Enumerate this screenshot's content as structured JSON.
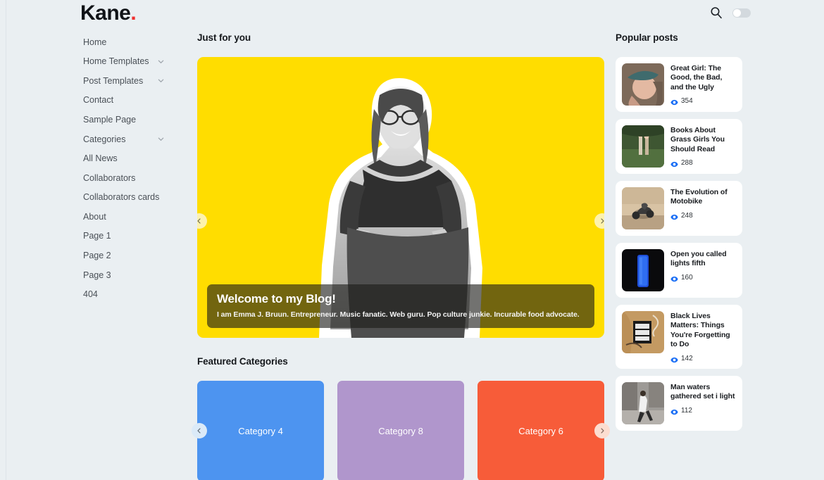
{
  "brand": {
    "name": "Kane",
    "dot": ".",
    "dot_color": "#f02f2f"
  },
  "header": {
    "search_icon": "search-icon",
    "toggle_state": "off"
  },
  "sidebar": {
    "items": [
      {
        "label": "Home",
        "expandable": false
      },
      {
        "label": "Home Templates",
        "expandable": true
      },
      {
        "label": "Post Templates",
        "expandable": true
      },
      {
        "label": "Contact",
        "expandable": false
      },
      {
        "label": "Sample Page",
        "expandable": false
      },
      {
        "label": "Categories",
        "expandable": true
      },
      {
        "label": "All News",
        "expandable": false
      },
      {
        "label": "Collaborators",
        "expandable": false
      },
      {
        "label": "Collaborators cards",
        "expandable": false
      },
      {
        "label": "About",
        "expandable": false
      },
      {
        "label": "Page 1",
        "expandable": false
      },
      {
        "label": "Page 2",
        "expandable": false
      },
      {
        "label": "Page 3",
        "expandable": false
      },
      {
        "label": "404",
        "expandable": false
      }
    ]
  },
  "main": {
    "just_for_you_title": "Just for you",
    "hero": {
      "background_color": "#ffdd00",
      "heading": "Welcome to my Blog!",
      "subheading": "I am Emma J. Bruun. Entrepreneur. Music fanatic. Web guru. Pop culture junkie. Incurable food advocate.",
      "prev_label": "‹",
      "next_label": "›"
    },
    "featured_title": "Featured Categories",
    "categories": [
      {
        "label": "Category 4",
        "color": "#4d94f0"
      },
      {
        "label": "Category 8",
        "color": "#b096cc"
      },
      {
        "label": "Category 6",
        "color": "#f75c39"
      }
    ],
    "categories_prev_label": "‹",
    "categories_next_label": "›"
  },
  "popular": {
    "title": "Popular posts",
    "posts": [
      {
        "title": "Great Girl: The Good, the Bad, and the Ugly",
        "views": "354",
        "thumb": "portrait-woman-hat"
      },
      {
        "title": "Books About Grass Girls You Should Read",
        "views": "288",
        "thumb": "girls-in-grass"
      },
      {
        "title": "The Evolution of Motobike",
        "views": "248",
        "thumb": "motorbike-road"
      },
      {
        "title": "Open you called lights fifth",
        "views": "160",
        "thumb": "blue-phone-dark"
      },
      {
        "title": "Black Lives Matters: Things You're Forgetting to Do",
        "views": "142",
        "thumb": "blm-poster-wall"
      },
      {
        "title": "Man waters gathered set i light",
        "views": "112",
        "thumb": "man-walking-street"
      }
    ]
  }
}
